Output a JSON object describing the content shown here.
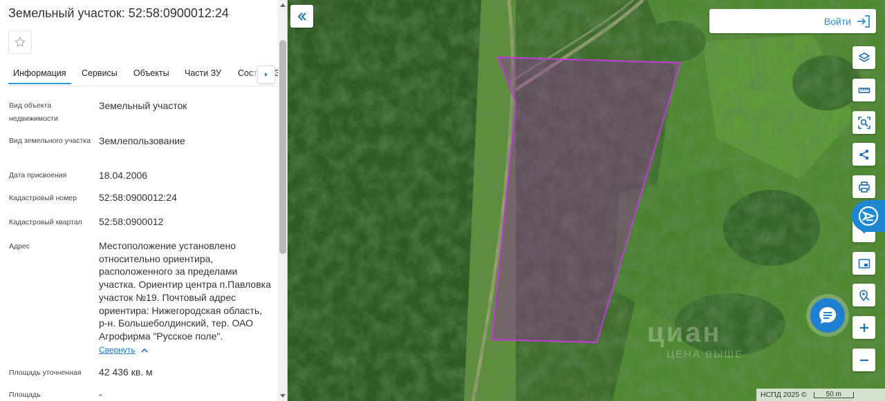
{
  "panel": {
    "title": "Земельный участок: 52:58:0900012:24",
    "tabs": [
      {
        "label": "Информация",
        "active": true
      },
      {
        "label": "Сервисы",
        "active": false
      },
      {
        "label": "Объекты",
        "active": false
      },
      {
        "label": "Части ЗУ",
        "active": false
      },
      {
        "label": "Состав ЕЗ",
        "active": false
      }
    ],
    "rows": [
      {
        "label": "Вид объекта недвижимости",
        "value": "Земельный участок"
      },
      {
        "label": "Вид земельного участка",
        "value": "Землепользование"
      },
      {
        "label": "Дата присвоения",
        "value": "18.04.2006"
      },
      {
        "label": "Кадастровый номер",
        "value": "52:58:0900012:24"
      },
      {
        "label": "Кадастровый квартал",
        "value": "52:58:0900012"
      },
      {
        "label": "Адрес",
        "value": "Местоположение установлено относительно ориентира, расположенного за пределами участка. Ориентир центра п.Павловка участок №19. Почтовый адрес ориентира: Нижегородская область, р-н. Большеболдинский, тер. ОАО Агрофирма \"Русское поле\"."
      },
      {
        "label": "Площадь уточненная",
        "value": "42 436 кв. м"
      },
      {
        "label": "Площадь",
        "value": "-"
      }
    ],
    "collapse_link": "Свернуть"
  },
  "map": {
    "login_label": "Войти",
    "copyright": "НСПД 2025 ©",
    "scale_label": "50 m",
    "watermark": "циан",
    "watermark_sub": "ЦЕНА ВЫШЕ",
    "parcel_color": "#c23ad8",
    "accent_color": "#1f7fd0"
  }
}
